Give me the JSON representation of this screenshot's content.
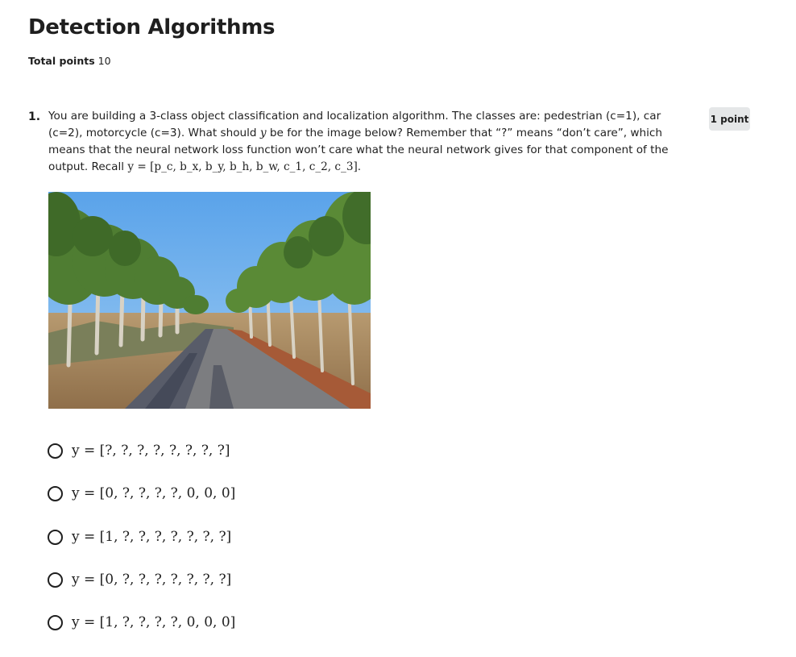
{
  "quiz": {
    "title": "Detection Algorithms",
    "total_points_label": "Total points",
    "total_points_value": "10"
  },
  "question": {
    "number": "1.",
    "text_part1": "You are building a 3-class object classification and localization algorithm. The classes are: pedestrian (c=1), car (c=2), motorcycle (c=3). What should ",
    "text_var": "y",
    "text_part2": " be for the image below? Remember that “?” means “don’t care”, which means that the neural network loss function won’t care what the neural network gives for that component of the output. Recall ",
    "formula": "y = [p_c, b_x, b_y, b_h, b_w, c_1, c_2, c_3]",
    "formula_suffix": ".",
    "points": "1 point",
    "image_icon": "tree-lined-road-photo"
  },
  "options": [
    {
      "label": "y = [?, ?, ?, ?, ?, ?, ?, ?]"
    },
    {
      "label": "y = [0, ?, ?, ?, ?, 0, 0, 0]"
    },
    {
      "label": "y = [1, ?, ?, ?, ?, ?, ?, ?]"
    },
    {
      "label": "y = [0, ?, ?, ?, ?, ?, ?, ?]"
    },
    {
      "label": "y = [1, ?, ?, ?, ?, 0, 0, 0]"
    }
  ],
  "colors": {
    "text": "#1f1f1f",
    "badge_bg": "#e5e7e8",
    "sky": "#6fb0ec",
    "foliage": "#4f7d32",
    "road": "#7c7d80"
  }
}
